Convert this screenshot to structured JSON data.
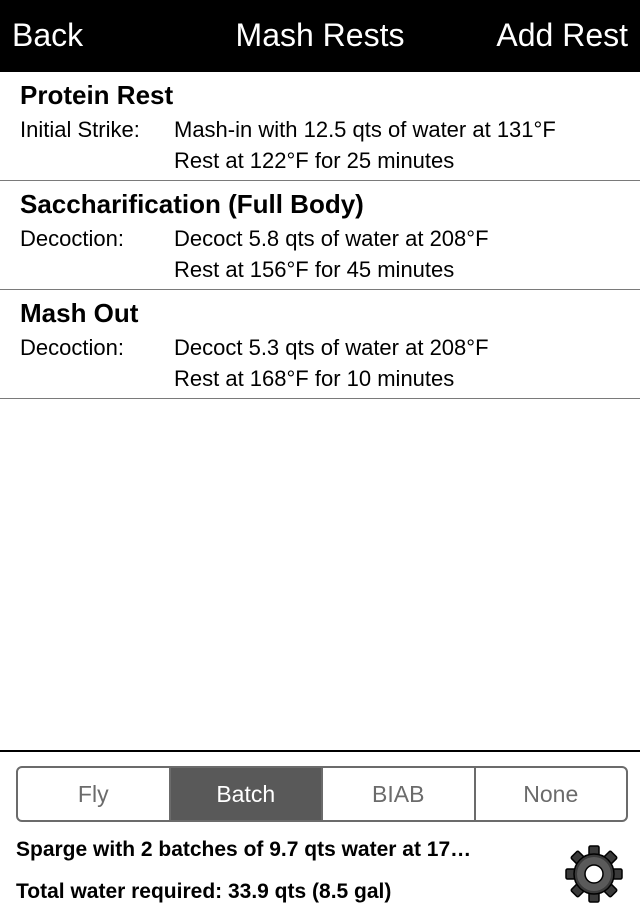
{
  "navbar": {
    "back_label": "Back",
    "title": "Mash Rests",
    "add_label": "Add Rest"
  },
  "rests": [
    {
      "name": "Protein Rest",
      "method": "Initial Strike:",
      "line1": "Mash-in with 12.5 qts of water at 131°F",
      "line2": "Rest at 122°F for 25 minutes"
    },
    {
      "name": "Saccharification (Full Body)",
      "method": "Decoction:",
      "line1": "Decoct 5.8 qts of water at 208°F",
      "line2": "Rest at 156°F for 45 minutes"
    },
    {
      "name": "Mash Out",
      "method": "Decoction:",
      "line1": "Decoct 5.3 qts of water at 208°F",
      "line2": "Rest at 168°F for 10 minutes"
    }
  ],
  "sparge": {
    "options": [
      "Fly",
      "Batch",
      "BIAB",
      "None"
    ],
    "selected": "Batch",
    "description": "Sparge with 2 batches of 9.7 qts water at 17…",
    "total_water": "Total water required: 33.9 qts (8.5 gal)",
    "settings_icon": "gear-icon"
  },
  "colors": {
    "navbar_bg": "#000000",
    "segment_selected_bg": "#595959",
    "segment_border": "#6b6b6b"
  }
}
